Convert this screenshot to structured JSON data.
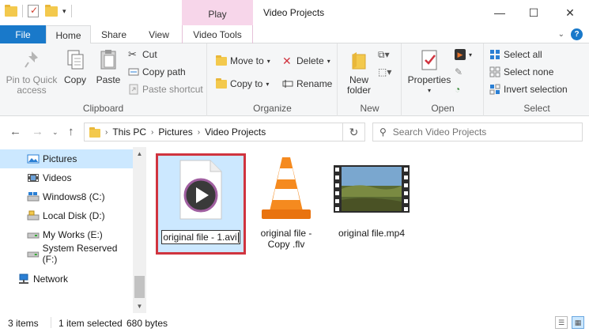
{
  "window": {
    "title": "Video Projects",
    "contextual_tab_group": "Play",
    "controls": [
      "—",
      "☐",
      "✕"
    ]
  },
  "ribbon_tabs": {
    "file": "File",
    "home": "Home",
    "share": "Share",
    "view": "View",
    "video_tools": "Video Tools"
  },
  "clipboard": {
    "pin": "Pin to Quick access",
    "copy": "Copy",
    "paste": "Paste",
    "cut": "Cut",
    "copy_path": "Copy path",
    "paste_shortcut": "Paste shortcut",
    "label": "Clipboard"
  },
  "organize": {
    "move_to": "Move to",
    "copy_to": "Copy to",
    "delete": "Delete",
    "rename": "Rename",
    "label": "Organize"
  },
  "new_group": {
    "new_folder": "New folder",
    "label": "New"
  },
  "open_group": {
    "properties": "Properties",
    "label": "Open"
  },
  "select_group": {
    "select_all": "Select all",
    "select_none": "Select none",
    "invert": "Invert selection",
    "label": "Select"
  },
  "address": {
    "crumbs": [
      "This PC",
      "Pictures",
      "Video Projects"
    ],
    "search_placeholder": "Search Video Projects"
  },
  "sidebar": {
    "items": [
      {
        "label": "Pictures",
        "selected": true
      },
      {
        "label": "Videos"
      },
      {
        "label": "Windows8 (C:)"
      },
      {
        "label": "Local Disk (D:)"
      },
      {
        "label": "My Works (E:)"
      },
      {
        "label": "System Reserved (F:)"
      },
      {
        "label": "Network"
      }
    ]
  },
  "files": [
    {
      "name": "original file - 1.avi",
      "icon": "avi-play-icon",
      "renaming": true
    },
    {
      "name": "original file - Copy .flv",
      "icon": "vlc-cone-icon"
    },
    {
      "name": "original file.mp4",
      "icon": "video-thumbnail-icon"
    }
  ],
  "status": {
    "count": "3 items",
    "selection": "1 item selected",
    "size": "680 bytes"
  },
  "colors": {
    "accent": "#1979ca",
    "play_tab": "#f7d6ea",
    "selection": "#cce8ff",
    "highlight_border": "#d0343f"
  }
}
